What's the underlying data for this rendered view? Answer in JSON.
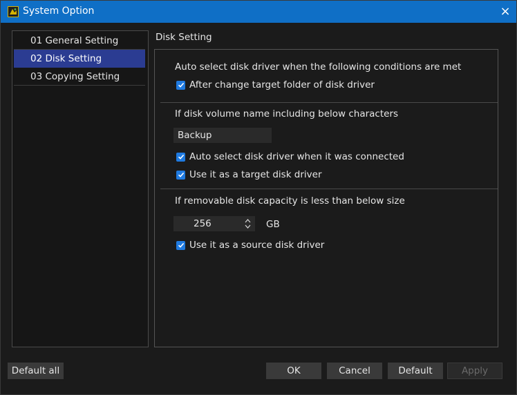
{
  "window": {
    "title": "System Option",
    "close_label": "×"
  },
  "sidebar": {
    "items": [
      {
        "label": "01 General Setting",
        "active": false
      },
      {
        "label": "02 Disk Setting",
        "active": true
      },
      {
        "label": "03 Copying Setting",
        "active": false
      }
    ]
  },
  "disk_setting": {
    "section_title": "Disk Setting",
    "group1": {
      "heading": "Auto select disk driver when the following conditions are met",
      "after_change_label": "After change target folder of disk driver",
      "after_change_checked": true
    },
    "group2": {
      "heading": "If disk volume name including below characters",
      "volume_name_value": "Backup",
      "auto_select_label": "Auto select disk driver when it was connected",
      "auto_select_checked": true,
      "use_target_label": "Use it as a target disk driver",
      "use_target_checked": true
    },
    "group3": {
      "heading": "If removable disk capacity is less than below size",
      "capacity_value": "256",
      "capacity_unit": "GB",
      "use_source_label": "Use it as a source disk driver",
      "use_source_checked": true
    }
  },
  "footer": {
    "default_all": "Default all",
    "ok": "OK",
    "cancel": "Cancel",
    "default": "Default",
    "apply": "Apply"
  },
  "colors": {
    "titlebar": "#0f6fc6",
    "active_item": "#2b3c92",
    "checkbox": "#1f7ae0"
  }
}
